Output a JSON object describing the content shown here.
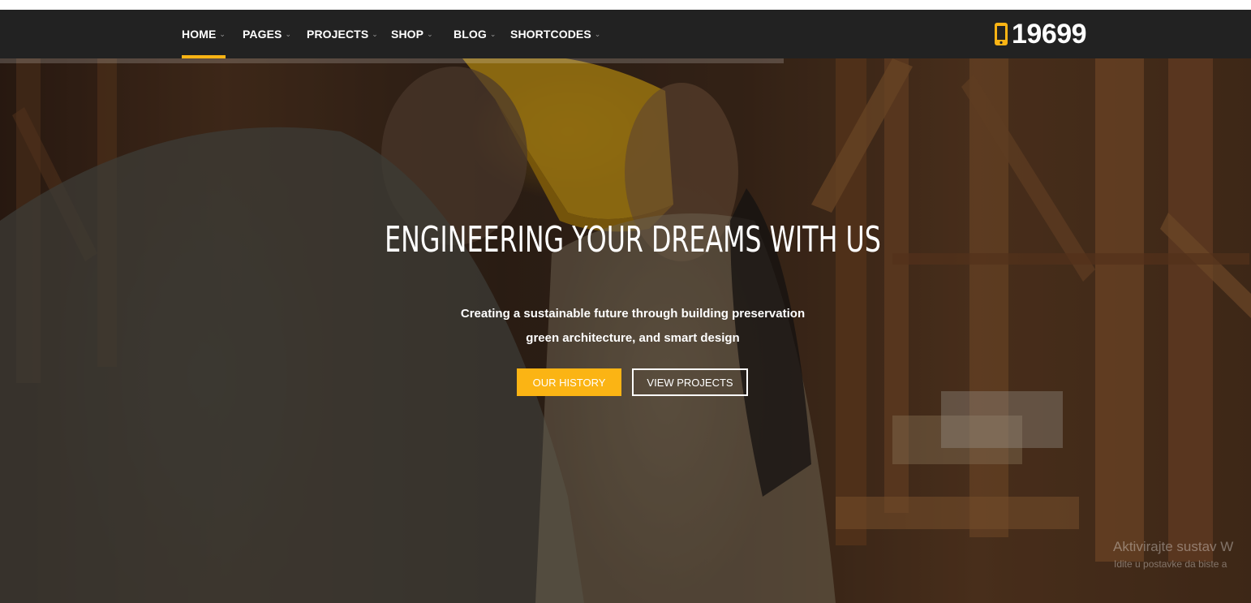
{
  "nav": {
    "items": [
      {
        "label": "HOME",
        "active": true
      },
      {
        "label": "PAGES",
        "active": false
      },
      {
        "label": "PROJECTS",
        "active": false
      },
      {
        "label": "SHOP",
        "active": false
      },
      {
        "label": "BLOG",
        "active": false
      },
      {
        "label": "SHORTCODES",
        "active": false
      }
    ],
    "phone_icon": "mobile-phone-icon",
    "phone_number": "19699"
  },
  "hero": {
    "headline": "ENGINEERING YOUR DREAMS WITH US",
    "subline1": "Creating a sustainable future through building preservation",
    "subline2": "green architecture, and smart design",
    "buttons": {
      "history": "OUR HISTORY",
      "projects": "VIEW PROJECTS"
    }
  },
  "watermark": {
    "line1": "Aktivirajte sustav W",
    "line2": "Idite u postavke da biste a"
  },
  "colors": {
    "accent": "#fbb414",
    "navbar": "#222222",
    "text": "#ffffff"
  }
}
